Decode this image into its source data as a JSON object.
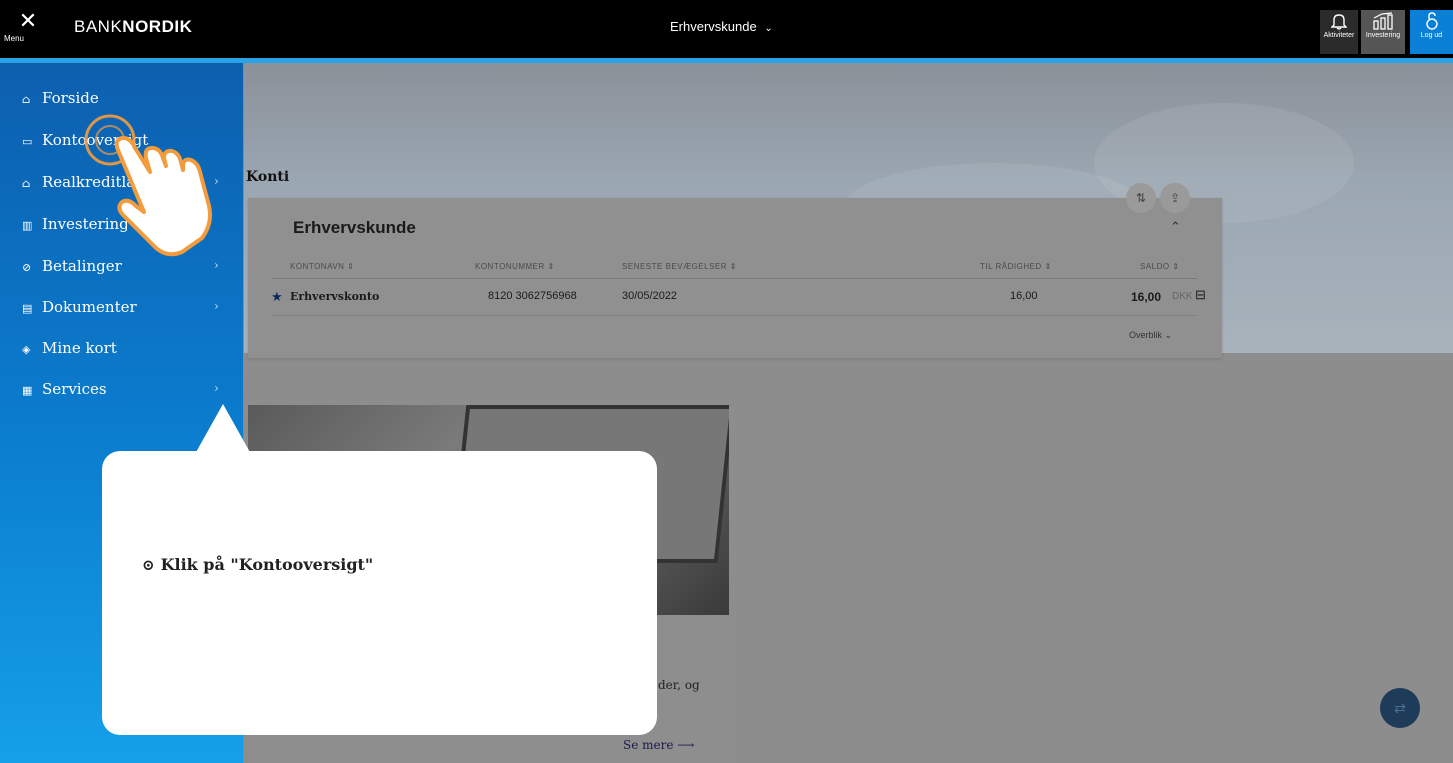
{
  "topbar": {
    "menu_icon": "close-icon",
    "menu_label": "Menu",
    "logo_light": "BANK",
    "logo_bold": "NORDIK",
    "customer_select": "Erhvervskunde",
    "actions": [
      {
        "label": "Aktiviteter",
        "icon": "bell-icon"
      },
      {
        "label": "Investering",
        "icon": "chart-icon"
      },
      {
        "label": "Log ud",
        "icon": "lock-icon"
      }
    ]
  },
  "sidebar": {
    "items": [
      {
        "label": "Forside",
        "icon": "home-icon",
        "has_children": false
      },
      {
        "label": "Kontooversigt",
        "icon": "wallet-icon",
        "has_children": false
      },
      {
        "label": "Realkreditlån",
        "icon": "house-loan-icon",
        "has_children": true
      },
      {
        "label": "Investering",
        "icon": "chart-icon",
        "has_children": false
      },
      {
        "label": "Betalinger",
        "icon": "payment-icon",
        "has_children": true
      },
      {
        "label": "Dokumenter",
        "icon": "document-icon",
        "has_children": true
      },
      {
        "label": "Mine kort",
        "icon": "card-icon",
        "has_children": false
      },
      {
        "label": "Services",
        "icon": "services-icon",
        "has_children": true
      }
    ]
  },
  "konti": {
    "title": "Konti",
    "group_title": "Erhvervskunde",
    "columns": [
      "KONTONAVN",
      "KONTONUMMER",
      "SENESTE BEVÆGELSER",
      "TIL RÅDIGHED",
      "SALDO"
    ],
    "rows": [
      {
        "name": "Erhvervskonto",
        "number": "8120 3062756968",
        "last_movement": "30/05/2022",
        "available": "16,00",
        "balance": "16,00",
        "currency": "DKK"
      }
    ],
    "overview_label": "Overblik"
  },
  "promo": {
    "text_fragment": "der, og",
    "link": "Se mere"
  },
  "tooltip": {
    "text": "Klik på \"Kontooversigt\""
  },
  "colors": {
    "sidebar_top": "#0d5fae",
    "sidebar_bottom": "#15a0e9",
    "accent_blue": "#0a7fd6",
    "hand_orange": "#f39c3d"
  }
}
